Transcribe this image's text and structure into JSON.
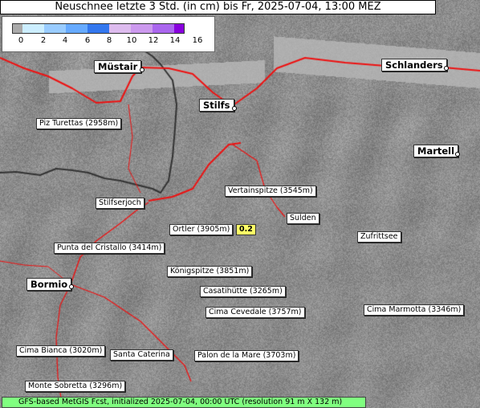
{
  "title": "Neuschnee letzte 3 Std. (in cm) bis Fr, 2025-07-04, 13:00 MEZ",
  "legend": {
    "ticks": [
      "0",
      "2",
      "4",
      "6",
      "8",
      "10",
      "12",
      "14",
      "16"
    ],
    "colors": [
      "#aaaaaa",
      "#cceeff",
      "#99ccff",
      "#66aaff",
      "#3377ee",
      "#ddbbee",
      "#cc99ee",
      "#aa66ee",
      "#8800dd"
    ]
  },
  "places": [
    {
      "name": "Müstair",
      "style": "big"
    },
    {
      "name": "Stilfs",
      "style": "big"
    },
    {
      "name": "Schlanders",
      "style": "big"
    },
    {
      "name": "Martell",
      "style": "big"
    },
    {
      "name": "Bormio",
      "style": "big"
    },
    {
      "name": "Piz Turettas (2958m)",
      "style": "small"
    },
    {
      "name": "Stilfserjoch",
      "style": "small"
    },
    {
      "name": "Vertainspitze (3545m)",
      "style": "small"
    },
    {
      "name": "Sulden",
      "style": "small"
    },
    {
      "name": "Ortler (3905m)",
      "style": "small"
    },
    {
      "name": "Zufrittsee",
      "style": "small"
    },
    {
      "name": "Punta del Cristallo (3414m)",
      "style": "small"
    },
    {
      "name": "Königspitze (3851m)",
      "style": "small"
    },
    {
      "name": "Casatihütte (3265m)",
      "style": "small"
    },
    {
      "name": "Cima Cevedale (3757m)",
      "style": "small"
    },
    {
      "name": "Cima Marmotta (3346m)",
      "style": "small"
    },
    {
      "name": "Cima Bianca (3020m)",
      "style": "small"
    },
    {
      "name": "Santa Caterina",
      "style": "small"
    },
    {
      "name": "Palon de la Mare (3703m)",
      "style": "small"
    },
    {
      "name": "Monte Sobretta (3296m)",
      "style": "small"
    }
  ],
  "value_label": "0.2",
  "footer": "GFS-based MetGIS Fcst, initialized 2025-07-04, 00:00 UTC  (resolution 91 m X 132 m)",
  "colors": {
    "valley": "#b0b0b0",
    "road": "#ee1111",
    "border": "#333333",
    "value_bg": "#ffff66",
    "footer_bg": "#80ff80"
  }
}
